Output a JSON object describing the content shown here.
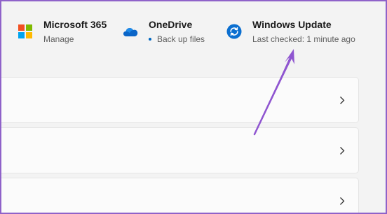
{
  "header": {
    "items": [
      {
        "title": "Microsoft 365",
        "subtitle": "Manage",
        "icon": "microsoft-365-icon"
      },
      {
        "title": "OneDrive",
        "subtitle": "Back up files",
        "icon": "onedrive-cloud-icon",
        "status_dot_color": "#0067c0"
      },
      {
        "title": "Windows Update",
        "subtitle": "Last checked: 1 minute ago",
        "icon": "windows-update-icon"
      }
    ]
  },
  "cards": [
    {
      "icon": "chevron-right-icon"
    },
    {
      "icon": "chevron-right-icon"
    },
    {
      "icon": "chevron-right-icon"
    }
  ],
  "colors": {
    "accent": "#0067c0",
    "annotation_arrow": "#8f55d0",
    "frame_border": "#8f62c9",
    "ms_red": "#f25022",
    "ms_green": "#7fba00",
    "ms_blue": "#00a4ef",
    "ms_yellow": "#ffb900"
  }
}
